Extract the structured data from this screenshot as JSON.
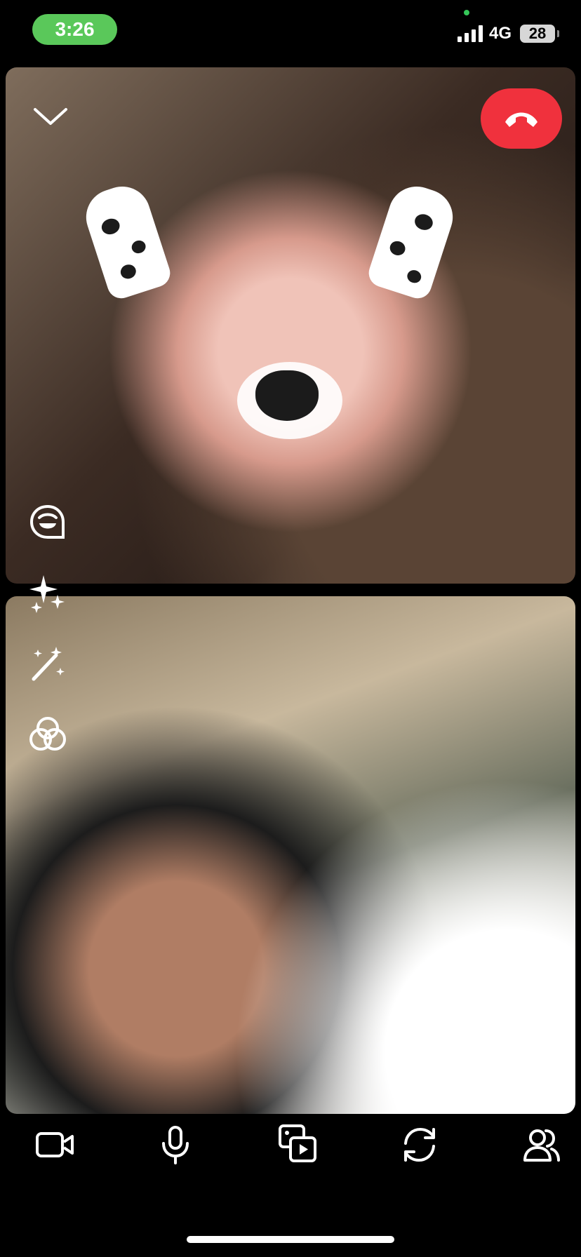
{
  "status_bar": {
    "time": "3:26",
    "network": "4G",
    "battery": "28"
  },
  "colors": {
    "time_pill": "#5ac85a",
    "end_call": "#f0313d",
    "background": "#000000"
  },
  "remote_video": {
    "collapse_icon": "chevron-down-icon",
    "end_call_icon": "phone-hangup-icon",
    "effect": "dalmatian-dog-ears-filter"
  },
  "side_tools": [
    {
      "name": "lens-icon"
    },
    {
      "name": "sparkles-icon"
    },
    {
      "name": "magic-wand-icon"
    },
    {
      "name": "filters-icon"
    }
  ],
  "bottom_bar": [
    {
      "name": "video-camera-icon"
    },
    {
      "name": "microphone-icon"
    },
    {
      "name": "media-share-icon"
    },
    {
      "name": "flip-camera-icon"
    },
    {
      "name": "participants-icon"
    }
  ]
}
